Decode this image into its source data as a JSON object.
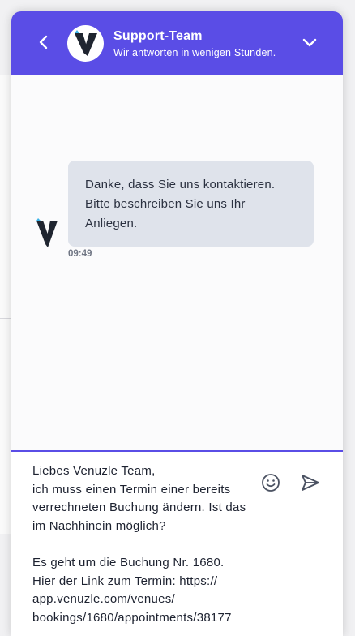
{
  "header": {
    "title": "Support-Team",
    "subtitle": "Wir antworten in wenigen Stunden.",
    "back_icon": "chevron-left-icon",
    "collapse_icon": "chevron-down-icon",
    "background_color": "#5a4de6"
  },
  "conversation": {
    "messages": [
      {
        "sender": "agent",
        "text": "Danke, dass Sie uns kontaktieren. Bitte beschreiben Sie uns Ihr Anliegen.",
        "time": "09:49"
      }
    ],
    "bubble_color": "#dfe3eb"
  },
  "composer": {
    "value": "Liebes Venuzle Team,\nich muss einen Termin einer bereits verrechneten Buchung ändern. Ist das im Nachhinein möglich?\n\nEs geht um die Buchung Nr. 1680.\nHier der Link zum Termin: https://\napp.venuzle.com/venues/\nbookings/1680/appointments/38177",
    "emoji_icon": "smiley-icon",
    "send_icon": "send-icon"
  },
  "branding": {
    "logo_icon": "venuzle-logo-icon",
    "powered_by_icon": "userlike-logo-icon"
  }
}
